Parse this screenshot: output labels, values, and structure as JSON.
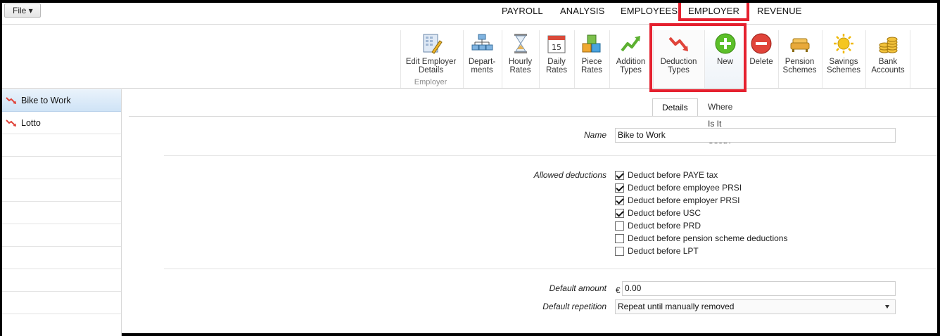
{
  "menubar": {
    "file_label": "File ▾",
    "tabs": [
      "PAYROLL",
      "ANALYSIS",
      "EMPLOYEES",
      "EMPLOYER",
      "REVENUE"
    ],
    "selected_tab": "EMPLOYER"
  },
  "ribbon": {
    "group_label": "Employer",
    "buttons": [
      {
        "label1": "Edit Employer",
        "label2": "Details",
        "icon": "edit-employer-icon"
      },
      {
        "label1": "Depart-",
        "label2": "ments",
        "icon": "departments-icon"
      },
      {
        "label1": "Hourly",
        "label2": "Rates",
        "icon": "hourglass-icon"
      },
      {
        "label1": "Daily",
        "label2": "Rates",
        "icon": "calendar-icon"
      },
      {
        "label1": "Piece",
        "label2": "Rates",
        "icon": "blocks-icon"
      },
      {
        "label1": "Addition",
        "label2": "Types",
        "icon": "trend-up-icon"
      },
      {
        "label1": "Deduction",
        "label2": "Types",
        "icon": "trend-down-icon"
      },
      {
        "label1": "New",
        "label2": "",
        "icon": "add-icon"
      },
      {
        "label1": "Delete",
        "label2": "",
        "icon": "remove-icon"
      },
      {
        "label1": "Pension",
        "label2": "Schemes",
        "icon": "sofa-icon"
      },
      {
        "label1": "Savings",
        "label2": "Schemes",
        "icon": "sun-icon"
      },
      {
        "label1": "Bank",
        "label2": "Accounts",
        "icon": "coins-icon"
      }
    ],
    "calendar_day": "15"
  },
  "list": {
    "items": [
      "Bike to Work",
      "Lotto"
    ],
    "selected": "Bike to Work"
  },
  "detail": {
    "tabs": [
      "Details",
      "Where Is It Used?"
    ],
    "active_tab": "Details",
    "name_label": "Name",
    "name_value": "Bike to Work",
    "allowed_label": "Allowed deductions",
    "deductions": [
      {
        "label": "Deduct before PAYE tax",
        "checked": true
      },
      {
        "label": "Deduct before employee PRSI",
        "checked": true
      },
      {
        "label": "Deduct before employer PRSI",
        "checked": true
      },
      {
        "label": "Deduct before USC",
        "checked": true
      },
      {
        "label": "Deduct before PRD",
        "checked": false
      },
      {
        "label": "Deduct before pension scheme deductions",
        "checked": false
      },
      {
        "label": "Deduct before LPT",
        "checked": false
      }
    ],
    "amount_label": "Default amount",
    "currency_symbol": "€",
    "amount_value": "0.00",
    "repetition_label": "Default repetition",
    "repetition_value": "Repeat until manually removed"
  },
  "colors": {
    "highlight": "#e5212f",
    "selection_bg": "#cfe3f6",
    "add_green": "#5cbf2a",
    "remove_red": "#e0443a"
  }
}
